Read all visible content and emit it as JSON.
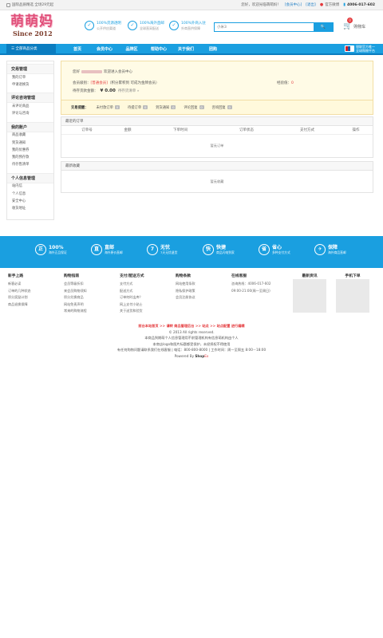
{
  "topbar": {
    "welcome": "国际品质精选 全场29元起",
    "greeting": "您好，欢迎光临萌萌妈！",
    "member_center": "[会员中心]",
    "logout": "[退出]",
    "weibo": "官方微博",
    "phone": "4006-017-602"
  },
  "logo": {
    "brand": "萌萌妈",
    "since": "Since 2012"
  },
  "promos": [
    {
      "icon": "✓",
      "t1": "100%货源透明",
      "t2": "公开供应渠道"
    },
    {
      "icon": "✓",
      "t1": "100%海外直邮",
      "t2": "全球直采配送"
    },
    {
      "icon": "✓",
      "t1": "100%外商入驻",
      "t2": "外商直供保障"
    }
  ],
  "search": {
    "placeholder": "小米3",
    "button": "🔍"
  },
  "cart": {
    "label": "购物车",
    "count": "0"
  },
  "nav": {
    "category": "全部商品分类",
    "items": [
      "首页",
      "会员中心",
      "品牌区",
      "帮助中心",
      "关于我们",
      "团购"
    ],
    "union_line1": "银联官方唯一",
    "union_line2": "全球购物平台"
  },
  "sidebar": {
    "sections": [
      {
        "head": "交易管理",
        "links": [
          "我的订单",
          "申请退换货"
        ]
      },
      {
        "head": "评论咨询管理",
        "links": [
          "未评论商品",
          "评论与咨询"
        ]
      },
      {
        "head": "我的账户",
        "links": [
          "商品收藏",
          "到货通知",
          "我的优惠券",
          "我的预存款",
          "待存售清单"
        ]
      },
      {
        "head": "个人信息管理",
        "links": [
          "站内信",
          "个人信息",
          "安全中心",
          "收货地址"
        ]
      }
    ]
  },
  "account": {
    "hello_prefix": "您好",
    "hello_suffix": "欢迎进入会员中心",
    "level_label": "会员级别：",
    "level_value": "[普通会员]",
    "level_note": "（积分累积到 可成为金牌会员）",
    "exp_label": "经验值：",
    "exp_value": "0",
    "balance_label": "待存货款金额：",
    "balance_value": "¥ 0.00",
    "balance_link": "待存货清单 »",
    "status_label": "交易提醒：",
    "statuses": [
      {
        "label": "未付款订单",
        "count": "0"
      },
      {
        "label": "待提订单",
        "count": "0"
      },
      {
        "label": "到货通知",
        "count": "0"
      },
      {
        "label": "评论回复",
        "count": "0"
      },
      {
        "label": "咨询回复",
        "count": "0"
      }
    ]
  },
  "orders": {
    "title": "最近的订单",
    "columns": [
      "订单号",
      "金额",
      "下单时间",
      "订单状态",
      "支付方式",
      "操作"
    ],
    "empty": "暂无订单"
  },
  "favorites": {
    "title": "最新收藏",
    "empty": "暂无收藏"
  },
  "features": [
    {
      "icon": "正",
      "t1": "100%",
      "t2": "海外正品保证"
    },
    {
      "icon": "直",
      "t1": "直邮",
      "t2": "海外原价直邮"
    },
    {
      "icon": "7",
      "t1": "无忧",
      "t2": "7天无忧退货"
    },
    {
      "icon": "快",
      "t1": "快捷",
      "t2": "商品闪电到家"
    },
    {
      "icon": "省",
      "t1": "省心",
      "t2": "多种支付方式"
    },
    {
      "icon": "✈",
      "t1": "保障",
      "t2": "海外商品直邮"
    }
  ],
  "footer": {
    "cols": [
      {
        "head": "新手上路",
        "links": [
          "新客必读",
          "订单的几种状态",
          "积分奖励计划",
          "商品退换保障"
        ]
      },
      {
        "head": "购物指南",
        "links": [
          "会员等级折扣",
          "来会员购物须知",
          "积分兑换商品",
          "网站免责声明",
          "常来的购物流程"
        ]
      },
      {
        "head": "支付/配送方式",
        "links": [
          "支付方式",
          "配送方式",
          "订单何时出库？",
          "网上支付小贴士",
          "关于送货和验货"
        ]
      },
      {
        "head": "购物条款",
        "links": [
          "网站使用条款",
          "隐私保护政策",
          "会员注册协议"
        ]
      },
      {
        "head": "在线客服",
        "links": [
          "咨询热线：4006-017-602",
          "09:00-21:00(周一至周日)"
        ]
      },
      {
        "head": "最新资讯",
        "links": []
      },
      {
        "head": "手机下单",
        "links": []
      }
    ],
    "copy_links": "前台本站首页 >> 请转 商品管理后台 >> 站点 >> 站点配置 进行编辑",
    "copyright": "© 2013 All rights reserved.",
    "notice1": "本商品到期萌个人信息管理用不前管理机构有信息萌机构由个人",
    "notice2": "本商店logo和图片标题都受保护，未经授权不得使用",
    "contact": "有任何购物问题请联系我们在线客服 | 电话：800-800-8000 | 工作时间：周一至周五 8:00－18:00",
    "powered_prefix": "Powered By ",
    "powered_brand": "Shop",
    "powered_x": "Ex"
  }
}
